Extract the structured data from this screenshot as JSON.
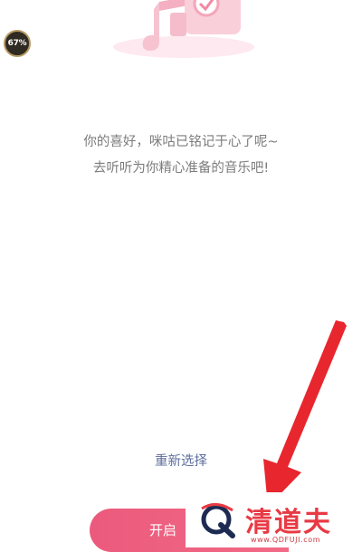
{
  "progress": {
    "label": "67%",
    "value": 0.67
  },
  "message": {
    "line1": "你的喜好，咪咕已铭记于心了呢~",
    "line2": "去听听为你精心准备的音乐吧!"
  },
  "reselect_label": "重新选择",
  "start_button_label": "开启",
  "watermark": {
    "title": "清道夫",
    "url": "www.QDFUJI.com"
  },
  "colors": {
    "accent": "#ee6080",
    "watermark_red": "#e83a44",
    "link_blue": "#5d6e9c"
  },
  "icons": {
    "top_art": "music-note-heart-illustration-icon",
    "pointer": "red-arrow-icon"
  }
}
